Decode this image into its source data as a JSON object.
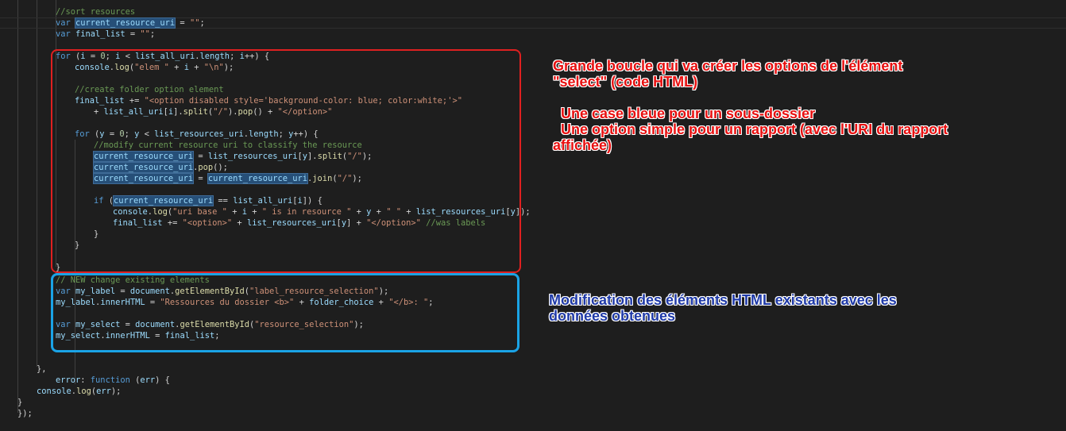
{
  "editor": {
    "lines": [
      {
        "segments": [
          {
            "t": "//sort resources",
            "c": "c"
          }
        ]
      },
      {
        "segments": [
          {
            "t": "var ",
            "c": "k"
          },
          {
            "t": "current_resource_uri",
            "c": "v",
            "hl": true
          },
          {
            "t": " = "
          },
          {
            "t": "\"\"",
            "c": "s"
          },
          {
            "t": ";"
          }
        ]
      },
      {
        "segments": [
          {
            "t": "var ",
            "c": "k"
          },
          {
            "t": "final_list",
            "c": "v"
          },
          {
            "t": " = "
          },
          {
            "t": "\"\"",
            "c": "s"
          },
          {
            "t": ";"
          }
        ]
      },
      {
        "segments": []
      },
      {
        "segments": [
          {
            "t": "for",
            "c": "k"
          },
          {
            "t": " ("
          },
          {
            "t": "i",
            "c": "v"
          },
          {
            "t": " = "
          },
          {
            "t": "0",
            "c": "n"
          },
          {
            "t": "; "
          },
          {
            "t": "i",
            "c": "v"
          },
          {
            "t": " < "
          },
          {
            "t": "list_all_uri",
            "c": "v"
          },
          {
            "t": "."
          },
          {
            "t": "length",
            "c": "v"
          },
          {
            "t": "; "
          },
          {
            "t": "i",
            "c": "v"
          },
          {
            "t": "++) {"
          }
        ]
      },
      {
        "segments": [
          {
            "t": "console",
            "c": "v"
          },
          {
            "t": "."
          },
          {
            "t": "log",
            "c": "f"
          },
          {
            "t": "("
          },
          {
            "t": "\"elem \"",
            "c": "s"
          },
          {
            "t": " + "
          },
          {
            "t": "i",
            "c": "v"
          },
          {
            "t": " + "
          },
          {
            "t": "\"\\n\"",
            "c": "s"
          },
          {
            "t": ");"
          }
        ]
      },
      {
        "segments": []
      },
      {
        "segments": [
          {
            "t": "//create folder option element",
            "c": "c"
          }
        ]
      },
      {
        "segments": [
          {
            "t": "final_list",
            "c": "v"
          },
          {
            "t": " += "
          },
          {
            "t": "\"<option disabled style='background-color: blue; color:white;'>\"",
            "c": "s"
          }
        ]
      },
      {
        "segments": [
          {
            "t": "+ "
          },
          {
            "t": "list_all_uri",
            "c": "v"
          },
          {
            "t": "["
          },
          {
            "t": "i",
            "c": "v"
          },
          {
            "t": "]."
          },
          {
            "t": "split",
            "c": "f"
          },
          {
            "t": "("
          },
          {
            "t": "\"/\"",
            "c": "s"
          },
          {
            "t": ")."
          },
          {
            "t": "pop",
            "c": "f"
          },
          {
            "t": "() + "
          },
          {
            "t": "\"</option>\"",
            "c": "s"
          }
        ]
      },
      {
        "segments": []
      },
      {
        "segments": [
          {
            "t": "for",
            "c": "k"
          },
          {
            "t": " ("
          },
          {
            "t": "y",
            "c": "v"
          },
          {
            "t": " = "
          },
          {
            "t": "0",
            "c": "n"
          },
          {
            "t": "; "
          },
          {
            "t": "y",
            "c": "v"
          },
          {
            "t": " < "
          },
          {
            "t": "list_resources_uri",
            "c": "v"
          },
          {
            "t": "."
          },
          {
            "t": "length",
            "c": "v"
          },
          {
            "t": "; "
          },
          {
            "t": "y",
            "c": "v"
          },
          {
            "t": "++) {"
          }
        ]
      },
      {
        "segments": [
          {
            "t": "//modify current resource uri to classify the resource",
            "c": "c"
          }
        ]
      },
      {
        "segments": [
          {
            "t": "current_resource_uri",
            "c": "v",
            "hl": true
          },
          {
            "t": " = "
          },
          {
            "t": "list_resources_uri",
            "c": "v"
          },
          {
            "t": "["
          },
          {
            "t": "y",
            "c": "v"
          },
          {
            "t": "]."
          },
          {
            "t": "split",
            "c": "f"
          },
          {
            "t": "("
          },
          {
            "t": "\"/\"",
            "c": "s"
          },
          {
            "t": ");"
          }
        ]
      },
      {
        "segments": [
          {
            "t": "current_resource_uri",
            "c": "v",
            "hl": true
          },
          {
            "t": "."
          },
          {
            "t": "pop",
            "c": "f"
          },
          {
            "t": "();"
          }
        ]
      },
      {
        "segments": [
          {
            "t": "current_resource_uri",
            "c": "v",
            "hl": true
          },
          {
            "t": " = "
          },
          {
            "t": "current_resource_uri",
            "c": "v",
            "hl": true
          },
          {
            "t": "."
          },
          {
            "t": "join",
            "c": "f"
          },
          {
            "t": "("
          },
          {
            "t": "\"/\"",
            "c": "s"
          },
          {
            "t": ");"
          }
        ]
      },
      {
        "segments": []
      },
      {
        "segments": [
          {
            "t": "if",
            "c": "k"
          },
          {
            "t": " ("
          },
          {
            "t": "current_resource_uri",
            "c": "v",
            "hl": true
          },
          {
            "t": " == "
          },
          {
            "t": "list_all_uri",
            "c": "v"
          },
          {
            "t": "["
          },
          {
            "t": "i",
            "c": "v"
          },
          {
            "t": "]) {"
          }
        ]
      },
      {
        "segments": [
          {
            "t": "console",
            "c": "v"
          },
          {
            "t": "."
          },
          {
            "t": "log",
            "c": "f"
          },
          {
            "t": "("
          },
          {
            "t": "\"uri base \"",
            "c": "s"
          },
          {
            "t": " + "
          },
          {
            "t": "i",
            "c": "v"
          },
          {
            "t": " + "
          },
          {
            "t": "\" is in resource \"",
            "c": "s"
          },
          {
            "t": " + "
          },
          {
            "t": "y",
            "c": "v"
          },
          {
            "t": " + "
          },
          {
            "t": "\" \"",
            "c": "s"
          },
          {
            "t": " + "
          },
          {
            "t": "list_resources_uri",
            "c": "v"
          },
          {
            "t": "["
          },
          {
            "t": "y",
            "c": "v"
          },
          {
            "t": "]);"
          }
        ]
      },
      {
        "segments": [
          {
            "t": "final_list",
            "c": "v"
          },
          {
            "t": " += "
          },
          {
            "t": "\"<option>\"",
            "c": "s"
          },
          {
            "t": " + "
          },
          {
            "t": "list_resources_uri",
            "c": "v"
          },
          {
            "t": "["
          },
          {
            "t": "y",
            "c": "v"
          },
          {
            "t": "] + "
          },
          {
            "t": "\"</option>\"",
            "c": "s"
          },
          {
            "t": " "
          },
          {
            "t": "//was labels",
            "c": "c"
          }
        ]
      },
      {
        "segments": [
          {
            "t": "}"
          }
        ]
      },
      {
        "segments": [
          {
            "t": "}"
          }
        ]
      },
      {
        "segments": []
      },
      {
        "segments": [
          {
            "t": "}"
          }
        ]
      },
      {
        "segments": [
          {
            "t": "// NEW change existing elements",
            "c": "c"
          }
        ]
      },
      {
        "segments": [
          {
            "t": "var ",
            "c": "k"
          },
          {
            "t": "my_label",
            "c": "v"
          },
          {
            "t": " = "
          },
          {
            "t": "document",
            "c": "v"
          },
          {
            "t": "."
          },
          {
            "t": "getElementById",
            "c": "f"
          },
          {
            "t": "("
          },
          {
            "t": "\"label_resource_selection\"",
            "c": "s"
          },
          {
            "t": ");"
          }
        ]
      },
      {
        "segments": [
          {
            "t": "my_label",
            "c": "v"
          },
          {
            "t": "."
          },
          {
            "t": "innerHTML",
            "c": "v"
          },
          {
            "t": " = "
          },
          {
            "t": "\"Ressources du dossier <b>\"",
            "c": "s"
          },
          {
            "t": " + "
          },
          {
            "t": "folder_choice",
            "c": "v"
          },
          {
            "t": " + "
          },
          {
            "t": "\"</b>: \"",
            "c": "s"
          },
          {
            "t": ";"
          }
        ]
      },
      {
        "segments": []
      },
      {
        "segments": [
          {
            "t": "var ",
            "c": "k"
          },
          {
            "t": "my_select",
            "c": "v"
          },
          {
            "t": " = "
          },
          {
            "t": "document",
            "c": "v"
          },
          {
            "t": "."
          },
          {
            "t": "getElementById",
            "c": "f"
          },
          {
            "t": "("
          },
          {
            "t": "\"resource_selection\"",
            "c": "s"
          },
          {
            "t": ");"
          }
        ]
      },
      {
        "segments": [
          {
            "t": "my_select",
            "c": "v"
          },
          {
            "t": "."
          },
          {
            "t": "innerHTML",
            "c": "v"
          },
          {
            "t": " = "
          },
          {
            "t": "final_list",
            "c": "v"
          },
          {
            "t": ";"
          }
        ]
      },
      {
        "segments": []
      },
      {
        "segments": []
      },
      {
        "segments": [
          {
            "t": "},"
          }
        ]
      },
      {
        "segments": [
          {
            "t": "error",
            "c": "v"
          },
          {
            "t": ": "
          },
          {
            "t": "function",
            "c": "k"
          },
          {
            "t": " ("
          },
          {
            "t": "err",
            "c": "v"
          },
          {
            "t": ") {"
          }
        ]
      },
      {
        "segments": [
          {
            "t": "console",
            "c": "v"
          },
          {
            "t": "."
          },
          {
            "t": "log",
            "c": "f"
          },
          {
            "t": "("
          },
          {
            "t": "err",
            "c": "v"
          },
          {
            "t": ");"
          }
        ]
      },
      {
        "segments": [
          {
            "t": "}"
          }
        ]
      },
      {
        "segments": [
          {
            "t": "});"
          }
        ]
      }
    ]
  },
  "annotations": {
    "red_note": "Grande boucle qui va créer les options de l'élément\n\"select\" (code HTML)\n\n  Une case bleue pour un sous-dossier\n  Une option simple pour un rapport (avec l'URI du rapport\naffichée)",
    "blue_note": "Modification des éléments HTML existants avec les\ndonnées obtenues"
  },
  "colors": {
    "background": "#1e1e1e",
    "keyword": "#569cd6",
    "string": "#ce9178",
    "comment": "#6a9955",
    "variable": "#9cdcfe",
    "red_annotation": "#e81010",
    "blue_annotation": "#1f3aa8",
    "blue_box": "#1aa3e6"
  }
}
